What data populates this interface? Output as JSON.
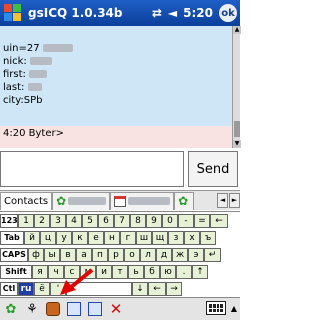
{
  "titlebar": {
    "app_title": "gsICQ 1.0.34b",
    "time": "5:20",
    "ok_label": "ok",
    "icons": [
      "windows-logo",
      "connectivity-icon",
      "volume-icon"
    ]
  },
  "message": {
    "uin_label": "uin=27",
    "nick_label": "nick:",
    "first_label": "first:",
    "last_label": "last:",
    "city_line": "city:SPb",
    "status_line": "4:20 Byter>"
  },
  "input": {
    "value": "",
    "send_label": "Send"
  },
  "tabs": [
    {
      "label": "Contacts"
    },
    {
      "label": "",
      "icon": "flower-icon"
    },
    {
      "label": "",
      "icon": "calendar-icon"
    },
    {
      "label": "",
      "icon": "flower-icon"
    }
  ],
  "keyboard": {
    "rows": [
      [
        "123",
        "1",
        "2",
        "3",
        "4",
        "5",
        "6",
        "7",
        "8",
        "9",
        "0",
        "-",
        "=",
        "←"
      ],
      [
        "Tab",
        "й",
        "ц",
        "у",
        "к",
        "е",
        "н",
        "г",
        "ш",
        "щ",
        "з",
        "х",
        "ъ"
      ],
      [
        "CAPS",
        "ф",
        "ы",
        "в",
        "а",
        "п",
        "р",
        "о",
        "л",
        "д",
        "ж",
        "э",
        "↵"
      ],
      [
        "Shift",
        "я",
        "ч",
        "с",
        "м",
        "и",
        "т",
        "ь",
        "б",
        "ю",
        ".",
        "↑"
      ],
      [
        "Ctl",
        "ru",
        "ё",
        "'",
        "",
        "↓",
        "←",
        "→"
      ]
    ]
  },
  "colors": {
    "titlebar": "#0b3f9a",
    "message_bg": "#cfe6f6",
    "key_bg": "#e7f1d6",
    "pink_bg": "#f9e2e2",
    "arrow": "#e00000"
  }
}
